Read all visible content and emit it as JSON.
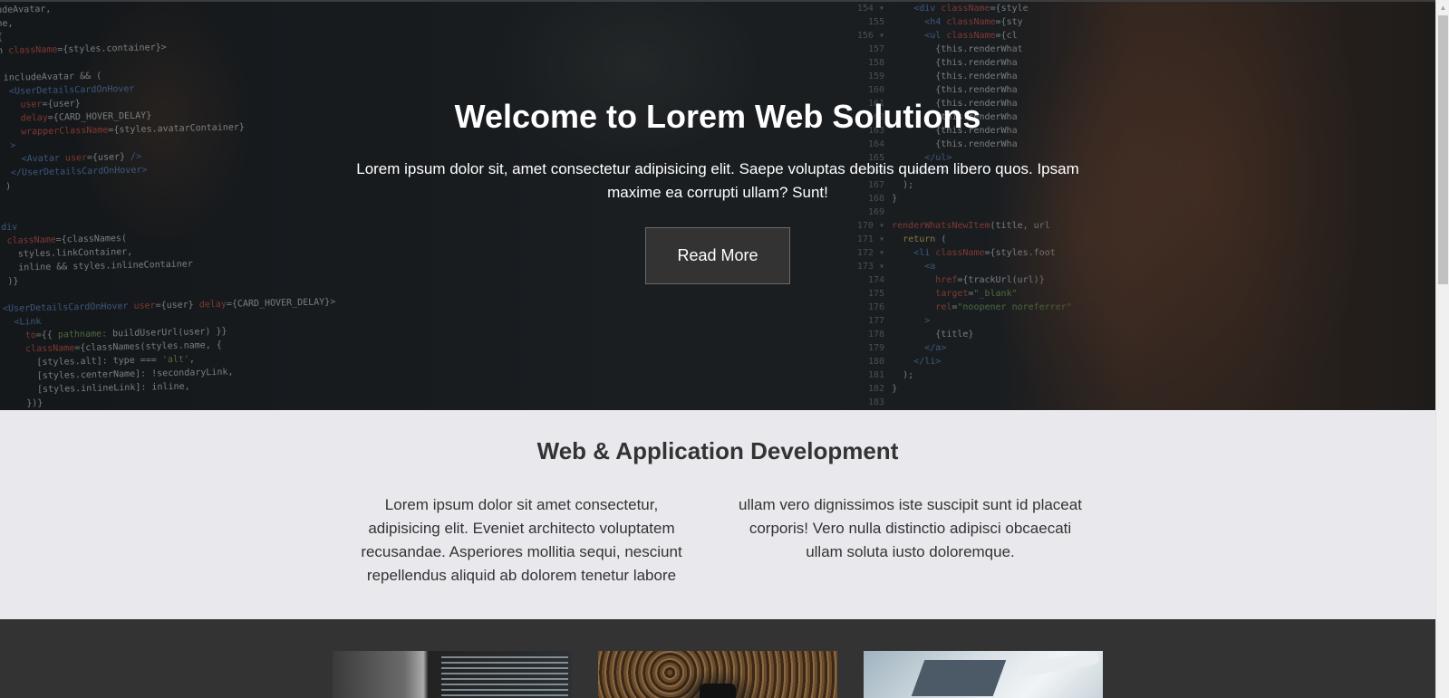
{
  "hero": {
    "title": "Welcome to Lorem Web Solutions",
    "subtitle": "Lorem ipsum dolor sit, amet consectetur adipisicing elit. Saepe voluptas debitis quidem libero quos. Ipsam maxime ea corrupti ullam? Sunt!",
    "button_label": "Read More"
  },
  "services": {
    "title": "Web & Application Development",
    "col1_text": "Lorem ipsum dolor sit amet consectetur, adipisicing elit. Eveniet architecto voluptatem recusandae. Asperiores mollitia sequi, nesciunt repellendus aliquid ab dolorem tenetur labore",
    "col2_text": "ullam vero dignissimos iste suscipit sunt id placeat corporis! Vero nulla distinctio adipisci obcaecati ullam soluta iusto doloremque."
  },
  "gallery": {
    "images": [
      "code-on-monitor-image",
      "phone-on-leaves-image",
      "laptop-writing-image"
    ]
  },
  "colors": {
    "services_bg": "#e9e9ed",
    "gallery_bg": "#333333",
    "button_bg": "#333333",
    "heading_text": "#333333"
  },
  "icons": {
    "scroll_up": "triangle-up"
  }
}
